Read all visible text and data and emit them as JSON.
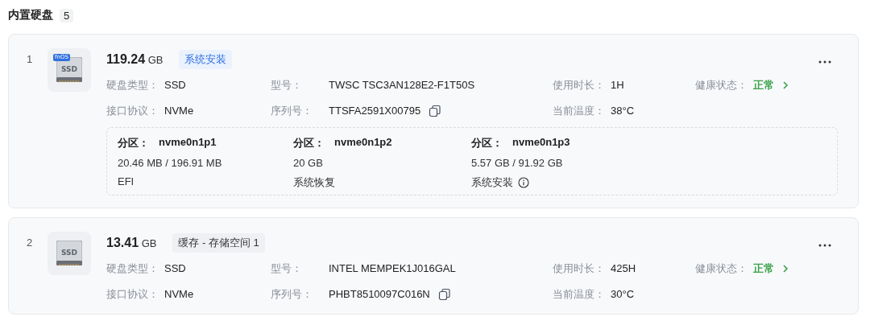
{
  "section": {
    "title": "内置硬盘",
    "count": "5"
  },
  "disks": [
    {
      "index": "1",
      "icon_badge": "fnOS",
      "icon_label": "SSD",
      "size": "119.24",
      "unit": "GB",
      "tag": {
        "text": "系统安装",
        "kind": "system"
      },
      "fields": [
        {
          "label": "硬盘类型：",
          "value": "SSD",
          "kind": "plain"
        },
        {
          "label": "型号：",
          "value": "TWSC TSC3AN128E2-F1T50S",
          "kind": "plain"
        },
        {
          "label": "使用时长：",
          "value": "1H",
          "kind": "plain"
        },
        {
          "label": "健康状态：",
          "value": "正常",
          "kind": "health"
        },
        {
          "label": "接口协议：",
          "value": "NVMe",
          "kind": "plain"
        },
        {
          "label": "序列号：",
          "value": "TTSFA2591X00795",
          "kind": "copy"
        },
        {
          "label": "当前温度：",
          "value": "38°C",
          "kind": "plain"
        }
      ],
      "partitions": [
        {
          "label": "分区：",
          "name": "nvme0n1p1",
          "usage": "20.46 MB / 196.91 MB",
          "purpose": "EFI",
          "info": false
        },
        {
          "label": "分区：",
          "name": "nvme0n1p2",
          "usage": "20 GB",
          "purpose": "系统恢复",
          "info": false
        },
        {
          "label": "分区：",
          "name": "nvme0n1p3",
          "usage": "5.57 GB / 91.92 GB",
          "purpose": "系统安装",
          "info": true
        }
      ]
    },
    {
      "index": "2",
      "icon_label": "SSD",
      "size": "13.41",
      "unit": "GB",
      "tag": {
        "text": "缓存 - 存储空间 1",
        "kind": "cache"
      },
      "fields": [
        {
          "label": "硬盘类型：",
          "value": "SSD",
          "kind": "plain"
        },
        {
          "label": "型号：",
          "value": "INTEL MEMPEK1J016GAL",
          "kind": "plain"
        },
        {
          "label": "使用时长：",
          "value": "425H",
          "kind": "plain"
        },
        {
          "label": "健康状态：",
          "value": "正常",
          "kind": "health"
        },
        {
          "label": "接口协议：",
          "value": "NVMe",
          "kind": "plain"
        },
        {
          "label": "序列号：",
          "value": "PHBT8510097C016N",
          "kind": "copy"
        },
        {
          "label": "当前温度：",
          "value": "30°C",
          "kind": "plain"
        }
      ]
    }
  ]
}
